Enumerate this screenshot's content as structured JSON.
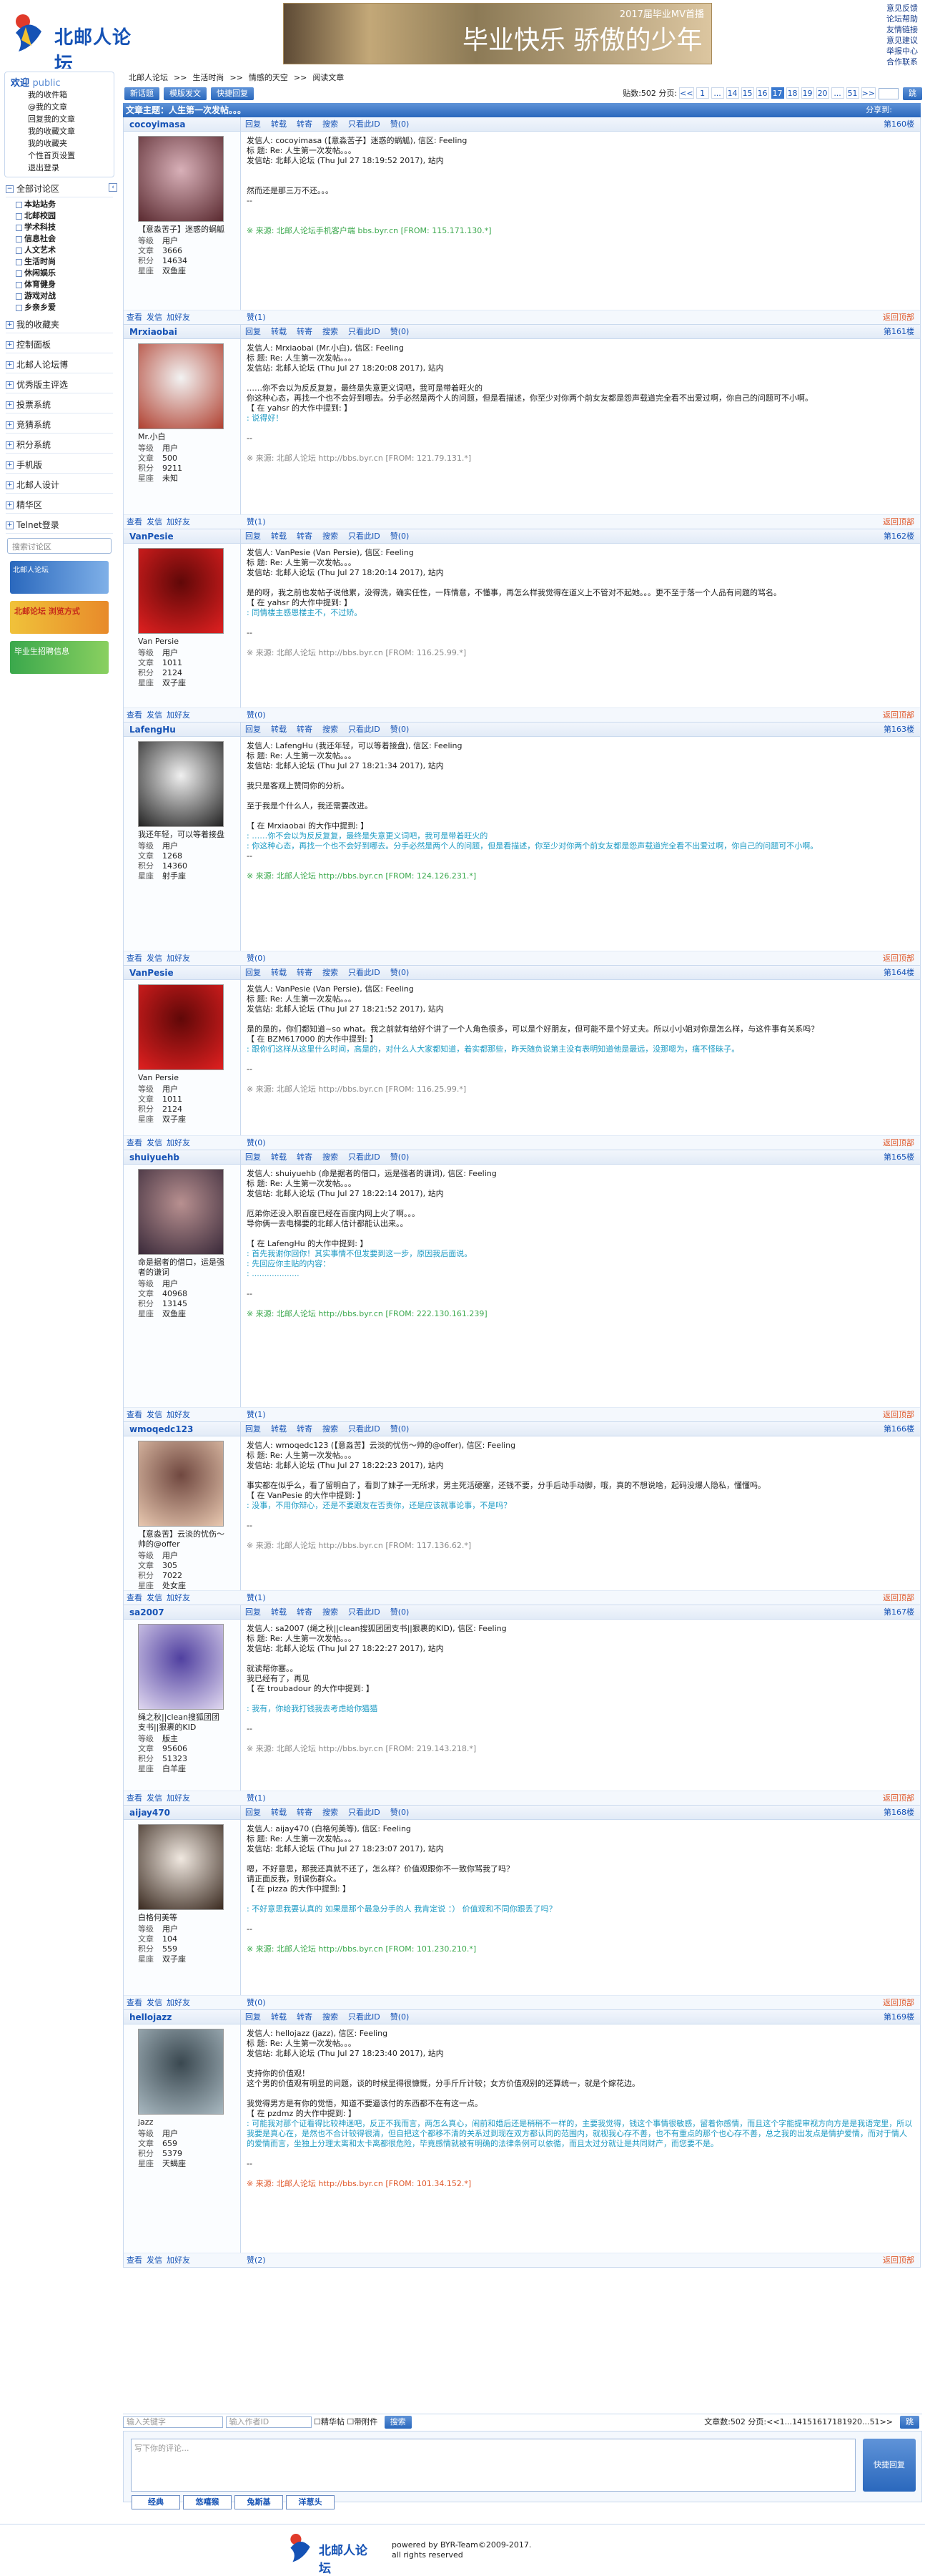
{
  "header": {
    "logo_text": "北邮人论坛",
    "banner_title": "2017届毕业MV首播",
    "banner_slogan": "毕业快乐 骄傲的少年",
    "top_links": [
      "意见反馈",
      "论坛帮助",
      "友情链接",
      "意见建议",
      "举报中心",
      "合作联系"
    ]
  },
  "sidebar": {
    "welcome": "欢迎",
    "user": "public",
    "user_links": [
      "我的收件箱",
      "@我的文章",
      "回复我的文章",
      "我的收藏文章",
      "我的收藏夹",
      "个性首页设置",
      "退出登录"
    ],
    "all_sections": "全部讨论区",
    "categories": [
      "本站站务",
      "北邮校园",
      "学术科技",
      "信息社会",
      "人文艺术",
      "生活时尚",
      "休闲娱乐",
      "体育健身",
      "游戏对战",
      "乡亲乡爱"
    ],
    "sections": [
      "我的收藏夹",
      "控制面板",
      "北邮人论坛博",
      "优秀版主评选",
      "投票系统",
      "竞猜系统",
      "积分系统",
      "手机版",
      "北邮人设计",
      "精华区",
      "Telnet登录"
    ],
    "search_placeholder": "搜索讨论区",
    "badges": [
      "北邮人论坛",
      "北邮论坛 浏览方式",
      "毕业生招聘信息"
    ]
  },
  "crumb": [
    "北邮人论坛",
    ">>",
    "生活时尚",
    ">>",
    "情感的天空",
    ">>",
    "阅读文章"
  ],
  "toolbar": {
    "buttons": [
      "新话题",
      "模版发文",
      "快捷回复"
    ],
    "post_count": "贴数:502",
    "page_label": "分页:",
    "pages": [
      "<<",
      "1",
      "...",
      "14",
      "15",
      "16",
      "17",
      "18",
      "19",
      "20",
      "...",
      "51",
      ">>"
    ],
    "go": "跳"
  },
  "thread": {
    "title": "文章主题：人生第一次发帖。。。",
    "share": "分享到:"
  },
  "actions": [
    "回复",
    "转载",
    "转寄",
    "搜索",
    "只看此ID",
    "赞(0)"
  ],
  "user_actions": [
    "查看",
    "发信",
    "加好友"
  ],
  "back_top": "返回顶部",
  "stat_labels": [
    "等级",
    "文章",
    "积分",
    "星座"
  ],
  "posts": [
    {
      "user": "cocoyimasa",
      "floor": "第160楼",
      "sig": "【意淼苦子】迷惑的蜗觚",
      "stats": [
        "用户",
        "3666",
        "14634",
        "双鱼座"
      ],
      "likes": "赞(1)",
      "lines": [
        "发信人: cocoyimasa (【意淼苦子】迷惑的蜗觚), 信区: Feeling",
        "标 题: Re: 人生第一次发帖。。。",
        "发信站: 北邮人论坛 (Thu Jul 27 18:19:52 2017), 站内",
        "",
        "",
        "然而还是那三万不还。。。",
        "--",
        "",
        "",
        "※ 来源: 北邮人论坛手机客户端 bbs.byr.cn [FROM: 115.171.130.*]"
      ],
      "src_type": "mobile"
    },
    {
      "user": "Mrxiaobai",
      "floor": "第161楼",
      "sig": "Mr.小白",
      "stats": [
        "用户",
        "500",
        "9211",
        "未知"
      ],
      "likes": "赞(1)",
      "lines": [
        "发信人: Mrxiaobai (Mr.小白), 信区: Feeling",
        "标 题: Re: 人生第一次发帖。。。",
        "发信站: 北邮人论坛 (Thu Jul 27 18:20:08 2017), 站内",
        "",
        "……你不会以为反反复复，最终是失意更义词吧，我可是带着旺火的",
        "你这种心态，再找一个也不会好到哪去。分手必然是两个人的问题，但是看描述，你至少对你两个前女友都是怨声载道完全看不出爱过啊，你自己的问题可不小啊。",
        "【 在 yahsr 的大作中提到: 】",
        ": 说得好！",
        "",
        "--",
        "",
        "※ 来源: 北邮人论坛 http://bbs.byr.cn [FROM: 121.79.131.*]"
      ],
      "src_type": "plain"
    },
    {
      "user": "VanPesie",
      "floor": "第162楼",
      "sig": "Van Persie",
      "stats": [
        "用户",
        "1011",
        "2124",
        "双子座"
      ],
      "likes": "赞(0)",
      "lines": [
        "发信人: VanPesie (Van Persie), 信区: Feeling",
        "标 题: Re: 人生第一次发帖。。。",
        "发信站: 北邮人论坛 (Thu Jul 27 18:20:14 2017), 站内",
        "",
        "是的呀，我之前也发帖子说他累，没得洗，确实任性，一阵情意，不懂事，再怎么样我觉得在道义上不管对不起她。。。更不至于落一个人品有问题的骂名。",
        "【 在 yahsr 的大作中提到: 】",
        ": 同情楼主感恩楼主不，不过矫。",
        "",
        "--",
        "",
        "※ 来源: 北邮人论坛 http://bbs.byr.cn [FROM: 116.25.99.*]"
      ],
      "src_type": "gray"
    },
    {
      "user": "LafengHu",
      "floor": "第163楼",
      "sig": "我还年轻，可以等着接盘",
      "stats": [
        "用户",
        "1268",
        "14360",
        "射手座"
      ],
      "likes": "赞(0)",
      "lines": [
        "发信人: LafengHu (我还年轻，可以等着接盘), 信区: Feeling",
        "标 题: Re: 人生第一次发帖。。。",
        "发信站: 北邮人论坛 (Thu Jul 27 18:21:34 2017), 站内",
        "",
        "我只是客观上赞同你的分析。",
        "",
        "至于我是个什么人，我还需要改进。",
        "",
        "【 在 Mrxiaobai 的大作中提到: 】",
        ": ……你不会以为反反复复，最终是失意更义词吧，我可是带着旺火的",
        ": 你这种心态，再找一个也不会好到哪去。分手必然是两个人的问题，但是看描述，你至少对你两个前女友都是怨声载道完全看不出爱过啊，你自己的问题可不小啊。",
        "--",
        "",
        "※ 来源: 北邮人论坛 http://bbs.byr.cn [FROM: 124.126.231.*]"
      ],
      "src_type": "green"
    },
    {
      "user": "VanPesie",
      "floor": "第164楼",
      "sig": "Van Persie",
      "stats": [
        "用户",
        "1011",
        "2124",
        "双子座"
      ],
      "likes": "赞(0)",
      "lines": [
        "发信人: VanPesie (Van Persie), 信区: Feeling",
        "标 题: Re: 人生第一次发帖。。。",
        "发信站: 北邮人论坛 (Thu Jul 27 18:21:52 2017), 站内",
        "",
        "是的是的，你们都知道~so what。我之前就有给好个讲了一个人角色很多，可以是个好朋友，但可能不是个好丈夫。所以小小姐对你是怎么样，与这件事有关系吗？",
        "【 在 BZM617000 的大作中提到: 】",
        ": 跟你们这样从这里什么时间，高是的，对什么人大家都知道，着实都那些，昨天随负说第主没有表明知道他是最远，没那嗯为，痛不怪昧子。",
        "",
        "--",
        "",
        "※ 来源: 北邮人论坛 http://bbs.byr.cn [FROM: 116.25.99.*]"
      ],
      "src_type": "gray"
    },
    {
      "user": "shuiyuehb",
      "floor": "第165楼",
      "sig": "命是据者的借口，运是强者的谦词",
      "stats": [
        "用户",
        "40968",
        "13145",
        "双鱼座"
      ],
      "likes": "赞(1)",
      "lines": [
        "发信人: shuiyuehb (命是据者的借口，运是强者的谦词), 信区: Feeling",
        "标 题: Re: 人生第一次发帖。。。",
        "发信站: 北邮人论坛 (Thu Jul 27 18:22:14 2017), 站内",
        "",
        "厄弟你还没入职百度已经在百度内网上火了啊。。。",
        "导你俩一去电梯要的北邮人估计都能认出来。。",
        "",
        "【 在 LafengHu 的大作中提到: 】",
        ": 首先我谢你回你！其实事情不但发要到这一步，原因我后面说。",
        ": 先回应你主贴的内容：",
        ": ...................",
        "",
        "--",
        "",
        "※ 来源: 北邮人论坛 http://bbs.byr.cn [FROM: 222.130.161.239]"
      ],
      "src_type": "green"
    },
    {
      "user": "wmoqedc123",
      "floor": "第166楼",
      "sig": "【意淼苦】云淡的忧伤～帅的@offer",
      "stats": [
        "用户",
        "305",
        "7022",
        "处女座"
      ],
      "likes": "赞(1)",
      "lines": [
        "发信人: wmoqedc123 (【意淼苦】云淡的忧伤～帅的@offer), 信区: Feeling",
        "标 题: Re: 人生第一次发帖。。。",
        "发信站: 北邮人论坛 (Thu Jul 27 18:22:23 2017), 站内",
        "",
        "事实都在似乎么，看了留明白了，看到了妹子一无所求，男主死活硬塞，还钱不要，分手后动手动脚，哦，真的不想说啥，起码没爆人隐私，懂懂吗。",
        "【 在 VanPesie 的大作中提到: 】",
        ": 没事，不用你辩心，还是不要跟友在否责你，还是应该就事论事，不是吗？",
        "",
        "--",
        "",
        "※ 来源: 北邮人论坛 http://bbs.byr.cn [FROM: 117.136.62.*]"
      ],
      "src_type": "plain"
    },
    {
      "user": "sa2007",
      "floor": "第167楼",
      "sig": "绳之秋||clean搜狐团团支书||狠裹的KID",
      "stats": [
        "版主",
        "95606",
        "51323",
        "白羊座"
      ],
      "likes": "赞(1)",
      "lines": [
        "发信人: sa2007 (绳之秋||clean搜狐团团支书||狠裹的KID), 信区: Feeling",
        "标 题: Re: 人生第一次发帖。。。",
        "发信站: 北邮人论坛 (Thu Jul 27 18:22:27 2017), 站内",
        "",
        "就读帮你塞。。",
        "我已经有了，再见",
        "【 在 troubadour 的大作中提到: 】",
        "",
        ": 我有，你给我打钱我去考虑给你猫猫",
        "",
        "--",
        "",
        "※ 来源: 北邮人论坛 http://bbs.byr.cn [FROM: 219.143.218.*]"
      ],
      "src_type": "gray"
    },
    {
      "user": "aijay470",
      "floor": "第168楼",
      "sig": "白格何美等",
      "stats": [
        "用户",
        "104",
        "559",
        "双子座"
      ],
      "likes": "赞(0)",
      "lines": [
        "发信人: aijay470 (白格何美等), 信区: Feeling",
        "标 题: Re: 人生第一次发帖。。。",
        "发信站: 北邮人论坛 (Thu Jul 27 18:23:07 2017), 站内",
        "",
        "嗯，不好意思，那我还真就不还了，怎么样？价值观跟你不一致你骂我了吗？",
        "请正面反我，别误伤群众。",
        "【 在 pizza 的大作中提到: 】",
        "",
        ": 不好意思我要认真的 如果是那个最急分手的人 我肯定说 ：） 价值观和不同你跟丢了吗？",
        "",
        "--",
        "",
        "※ 来源: 北邮人论坛 http://bbs.byr.cn [FROM: 101.230.210.*]"
      ],
      "src_type": "green"
    },
    {
      "user": "hellojazz",
      "floor": "第169楼",
      "sig": "jazz",
      "stats": [
        "用户",
        "659",
        "5379",
        "天蝎座"
      ],
      "likes": "赞(2)",
      "lines": [
        "发信人: hellojazz (jazz), 信区: Feeling",
        "标 题: Re: 人生第一次发帖。。。",
        "发信站: 北邮人论坛 (Thu Jul 27 18:23:40 2017), 站内",
        "",
        "支持你的价值观！",
        "这个男的价值观有明显的问题，谈的时候显得很慷慨，分手斤斤计较；女方价值观别的还算统一，就是个嫁花边。",
        "",
        "我觉得男方是有你的觉悟，知道不要逼该付的东西都不在有这一点。",
        "【 在 pzdmz 的大作中提到: 】",
        ": 可能我对那个证看得比较神迷吧，反正不我而言，两怎么真心，闹前和婚后还是稍稍不一样的，主要我觉得，钱这个事情很敏感，留着你感情，而且这个字能提审视方向方是是我语宠里，所以我要是真心在，是然也不合计较得很清，但自把这个都移不清的关系过到现在双方都认同的范围内，就视我心存不善，也不有重点的那个也心存不善，总之我的出发点是情护爱情，而对于情人的爱情而言，坐独上分理太离和太卡离都很危险，毕竟感情就被有明确的法律条例可以依循，而且太过分就让是共同财产，而您要不是。",
        "",
        "--",
        "",
        "※ 来源: 北邮人论坛 http://bbs.byr.cn [FROM: 101.34.152.*]"
      ],
      "src_type": "red"
    }
  ],
  "bottom_bar": {
    "search_user": "输入关键字",
    "search_id": "输入作者ID",
    "elite": "精华帖",
    "attach": "带附件",
    "search": "搜索",
    "post_count": "文章数:502",
    "page_label": "分页:"
  },
  "reply": {
    "placeholder": "写下你的评论...",
    "quick_reply": "快捷回复"
  },
  "tabs": [
    "经典",
    "悠嘻猴",
    "兔斯基",
    "洋葱头"
  ],
  "footer": {
    "powered": "powered by BYR-Team©2009-2017.",
    "rights": "all rights reserved"
  }
}
